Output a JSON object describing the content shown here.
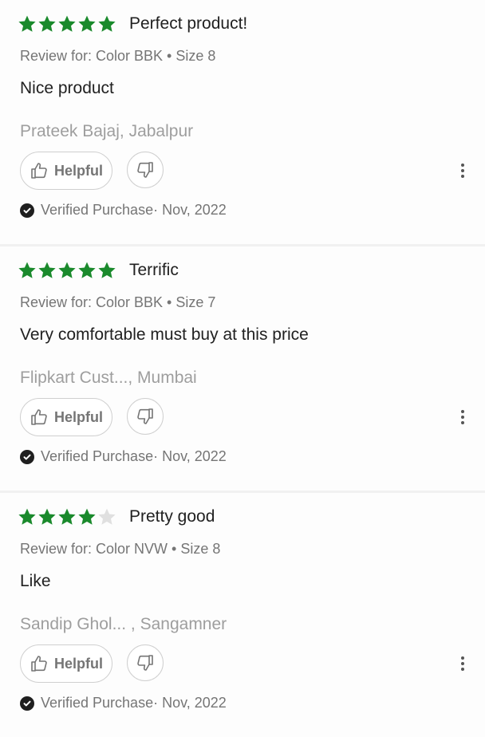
{
  "colors": {
    "star_filled": "#1a8a2c",
    "star_empty": "#e0e0e0"
  },
  "reviews": [
    {
      "rating": 5,
      "title": "Perfect product!",
      "variant": "Review for: Color BBK • Size 8",
      "body": "Nice product",
      "author": "Prateek Bajaj, Jabalpur",
      "helpful_label": "Helpful",
      "verified_text": "Verified Purchase· Nov, 2022"
    },
    {
      "rating": 5,
      "title": "Terrific",
      "variant": "Review for: Color BBK • Size 7",
      "body": "Very comfortable must buy at this price",
      "author": "Flipkart Cust..., Mumbai",
      "helpful_label": "Helpful",
      "verified_text": "Verified Purchase· Nov, 2022"
    },
    {
      "rating": 4,
      "title": "Pretty good",
      "variant": "Review for: Color NVW • Size 8",
      "body": "Like",
      "author": "Sandip Ghol... , Sangamner",
      "helpful_label": "Helpful",
      "verified_text": "Verified Purchase· Nov, 2022"
    }
  ]
}
